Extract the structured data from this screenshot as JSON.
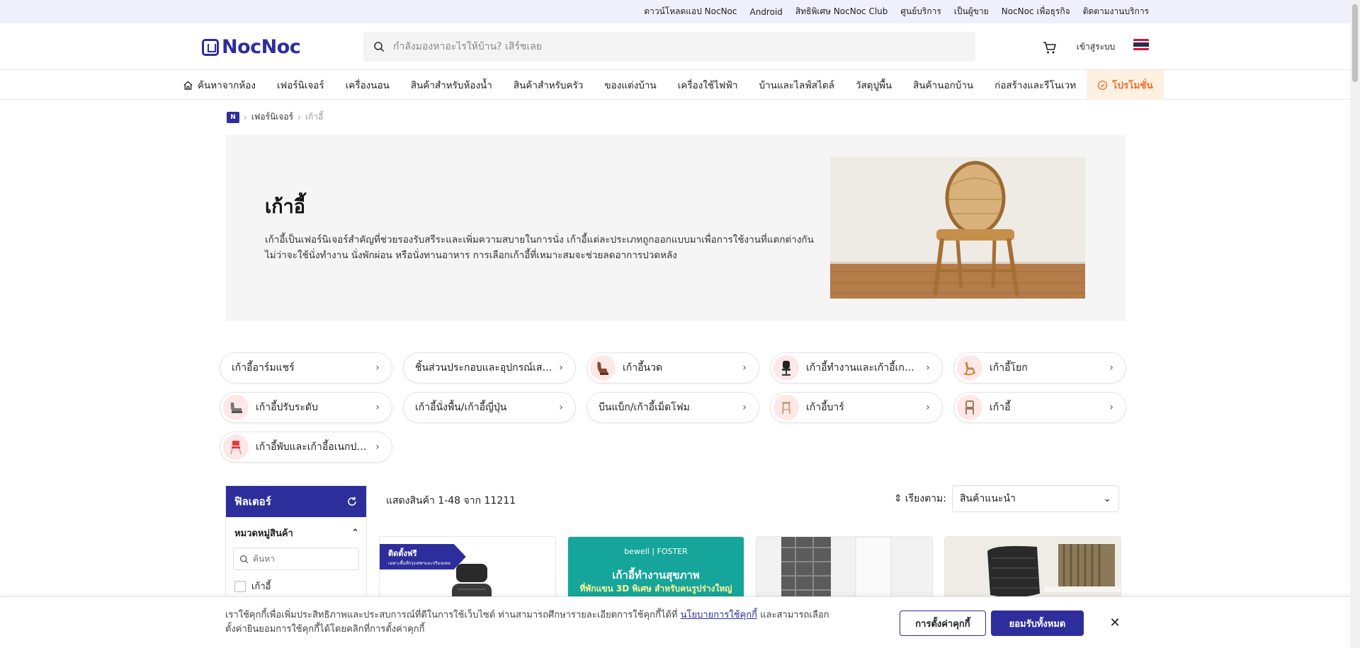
{
  "colors": {
    "brand": "#2d2e9c",
    "promo": "#ef6b2c",
    "promo_bg": "#fff1e2",
    "teal": "#16a59b"
  },
  "topbar": {
    "links": [
      "ดาวน์โหลดแอป NocNoc",
      "Android",
      "สิทธิพิเศษ NocNoc Club",
      "ศูนย์บริการ",
      "เป็นผู้ขาย",
      "NocNoc เพื่อธุรกิจ",
      "ติดตามงานบริการ"
    ]
  },
  "header": {
    "logo": "NocNoc",
    "search_placeholder": "กำลังมองหาอะไรให้บ้าน? เสิร์ชเลย",
    "login_label": "เข้าสู่ระบบ",
    "cart_icon": "cart-icon",
    "language_icon": "thai-flag-icon"
  },
  "nav": {
    "items": [
      "ค้นหาจากห้อง",
      "เฟอร์นิเจอร์",
      "เครื่องนอน",
      "สินค้าสำหรับห้องน้ำ",
      "สินค้าสำหรับครัว",
      "ของแต่งบ้าน",
      "เครื่องใช้ไฟฟ้า",
      "บ้านและไลฟ์สไตล์",
      "วัสดุปูพื้น",
      "สินค้านอกบ้าน",
      "ก่อสร้างและรีโนเวท"
    ],
    "promo_label": "โปรโมชั่น"
  },
  "breadcrumb": {
    "home_icon": "home-logo-icon",
    "level1": "เฟอร์นิเจอร์",
    "current": "เก้าอี้"
  },
  "hero": {
    "title": "เก้าอี้",
    "description": "เก้าอี้เป็นเฟอร์นิเจอร์สำคัญที่ช่วยรองรับสรีระและเพิ่มความสบายในการนั่ง เก้าอี้แต่ละประเภทถูกออกแบบมาเพื่อการใช้งานที่แตกต่างกัน ไม่ว่าจะใช้นั่งทำงาน นั่งพักผ่อน หรือนั่งทานอาหาร การเลือกเก้าอี้ที่เหมาะสมจะช่วยลดอาการปวดหลัง"
  },
  "subcategories": [
    {
      "label": "เก้าอี้อาร์มแชร์",
      "icon": "armchair-icon"
    },
    {
      "label": "ชิ้นส่วนประกอบและอุปกรณ์เสริมเก้าอี้",
      "icon": "chair-parts-icon"
    },
    {
      "label": "เก้าอี้นวด",
      "icon": "massage-chair-icon"
    },
    {
      "label": "เก้าอี้ทำงานและเก้าอี้เกมมิ่ง",
      "icon": "office-chair-icon"
    },
    {
      "label": "เก้าอี้โยก",
      "icon": "rocking-chair-icon"
    },
    {
      "label": "เก้าอี้ปรับระดับ",
      "icon": "recliner-icon"
    },
    {
      "label": "เก้าอี้นั่งพื้น/เก้าอี้ญี่ปุ่น",
      "icon": "floor-chair-icon"
    },
    {
      "label": "บีนแบ็ก/เก้าอี้เม็ดโฟม",
      "icon": "beanbag-icon"
    },
    {
      "label": "เก้าอี้บาร์",
      "icon": "bar-stool-icon"
    },
    {
      "label": "เก้าอี้",
      "icon": "chair-icon"
    },
    {
      "label": "เก้าอี้พับและเก้าอี้อเนกประสงค์",
      "icon": "folding-chair-icon"
    }
  ],
  "filter": {
    "title": "ฟิลเตอร์",
    "section_title": "หมวดหมู่สินค้า",
    "search_placeholder": "ค้นหา",
    "first_option": "เก้าอี้"
  },
  "results": {
    "count_text": "แสดงสินค้า 1-48 จาก 11211"
  },
  "sort": {
    "label": "เรียงตาม:",
    "value": "สินค้าแนะนำ"
  },
  "products": {
    "badge_label": "ติดตั้งฟรี",
    "badge_sub": "เฉพาะพื้นที่กรุงเทพฯและปริมณฑล",
    "promo_brand": "bewell | FOSTER",
    "promo_title": "เก้าอี้ทำงานสุขภาพ",
    "promo_subtitle": "ที่พักแขน 3D พิเศษ สำหรับคนรูปร่างใหญ่"
  },
  "cookie": {
    "text_before": "เราใช้คุกกี้เพื่อเพิ่มประสิทธิภาพและประสบการณ์ที่ดีในการใช้เว็บไซต์ ท่านสามารถศึกษารายละเอียดการใช้คุกกี้ได้ที่ ",
    "policy_link": "นโยบายการใช้คุกกี้",
    "text_after": " และสามารถเลือกตั้งค่ายินยอมการใช้คุกกี้ได้โดยคลิกที่การตั้งค่าคุกกี้",
    "settings_label": "การตั้งค่าคุกกี้",
    "accept_label": "ยอมรับทั้งหมด"
  }
}
